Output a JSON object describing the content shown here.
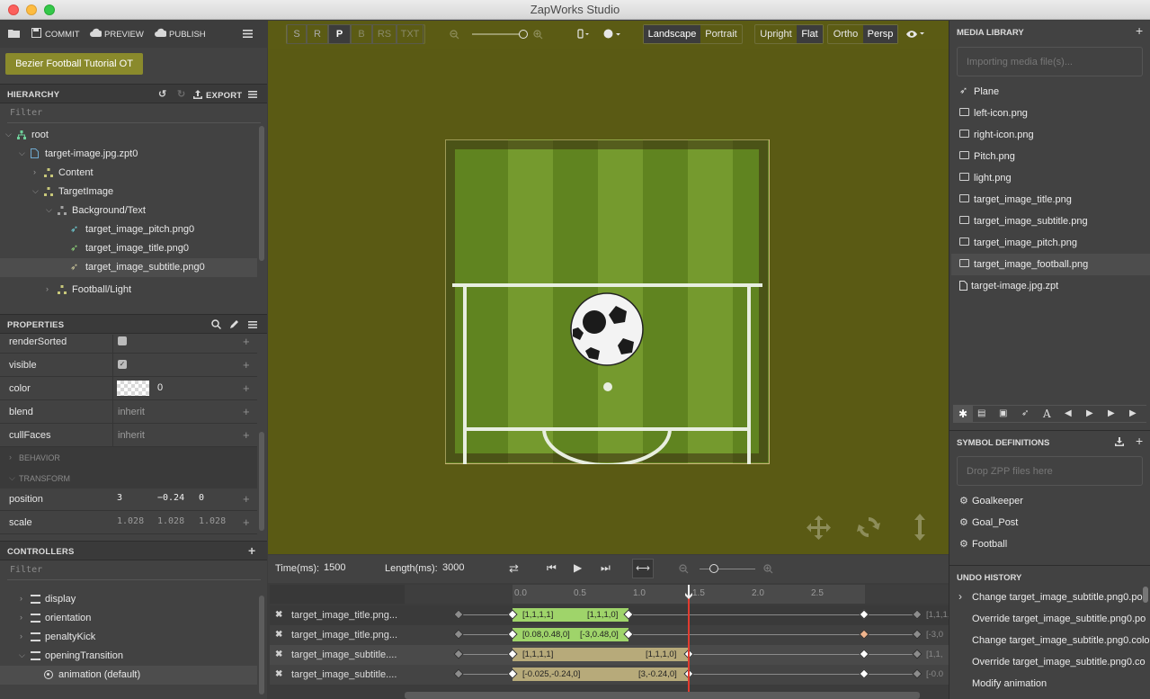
{
  "window": {
    "title": "ZapWorks Studio"
  },
  "colors": {
    "accent_gold": "#8a8a2c",
    "viewport_bg": "#5a5a14",
    "keyframe_green": "#9fd46a",
    "keyframe_tan": "#b7aa7a",
    "playhead": "#e23b2f",
    "diamond_orange": "#f0b48c"
  },
  "top_toolbar": {
    "commit": "COMMIT",
    "preview": "PREVIEW",
    "publish": "PUBLISH",
    "project_button": "Bezier Football Tutorial OT"
  },
  "hierarchy": {
    "title": "HIERARCHY",
    "export": "EXPORT",
    "filter": "Filter",
    "items": [
      {
        "label": "root"
      },
      {
        "label": "target-image.jpg.zpt0"
      },
      {
        "label": "Content"
      },
      {
        "label": "TargetImage"
      },
      {
        "label": "Background/Text"
      },
      {
        "label": "target_image_pitch.png0"
      },
      {
        "label": "target_image_title.png0"
      },
      {
        "label": "target_image_subtitle.png0"
      },
      {
        "label": "Football/Light"
      }
    ]
  },
  "properties": {
    "title": "PROPERTIES",
    "rows": [
      {
        "name": "renderSorted"
      },
      {
        "name": "visible"
      },
      {
        "name": "color",
        "value": "0"
      },
      {
        "name": "blend",
        "value": "inherit"
      },
      {
        "name": "cullFaces",
        "value": "inherit"
      }
    ],
    "behavior": "BEHAVIOR",
    "transform": "TRANSFORM",
    "position": {
      "name": "position",
      "x": "3",
      "y": "−0.24",
      "z": "0"
    },
    "scale": {
      "name": "scale",
      "x": "1.028",
      "y": "1.028",
      "z": "1.028"
    }
  },
  "controllers": {
    "title": "CONTROLLERS",
    "filter": "Filter",
    "items": [
      {
        "label": "display"
      },
      {
        "label": "orientation"
      },
      {
        "label": "penaltyKick"
      },
      {
        "label": "openingTransition"
      },
      {
        "label": "animation (default)"
      }
    ]
  },
  "viewport_toolbar": {
    "modes": [
      "S",
      "R",
      "P",
      "B",
      "RS",
      "TXT"
    ],
    "active_mode": "P",
    "orientation": [
      "Landscape",
      "Portrait"
    ],
    "view": [
      "Upright",
      "Flat"
    ],
    "projection": [
      "Ortho",
      "Persp"
    ]
  },
  "timeline": {
    "time_label": "Time(ms):",
    "time_value": "1500",
    "length_label": "Length(ms):",
    "length_value": "3000",
    "ruler": [
      "0.0",
      "0.5",
      "1.0",
      "1.5",
      "2.0",
      "2.5"
    ],
    "tracks": [
      {
        "name": "target_image_title.png...",
        "k1": "[1,1,1,1]",
        "k2": "[1,1,1,0]",
        "end": "[1,1,1,"
      },
      {
        "name": "target_image_title.png...",
        "k1": "[0.08,0.48,0]",
        "k2": "[-3,0.48,0]",
        "end": "[-3,0"
      },
      {
        "name": "target_image_subtitle....",
        "k1": "[1,1,1,1]",
        "k2": "[1,1,1,0]",
        "end": "[1,1,"
      },
      {
        "name": "target_image_subtitle....",
        "k1": "[-0.025,-0.24,0]",
        "k2": "[3,-0.24,0]",
        "end": "[-0.0"
      }
    ]
  },
  "media_library": {
    "title": "MEDIA LIBRARY",
    "drop_hint": "Importing media file(s)...",
    "items": [
      {
        "label": "Plane"
      },
      {
        "label": "left-icon.png"
      },
      {
        "label": "right-icon.png"
      },
      {
        "label": "Pitch.png"
      },
      {
        "label": "light.png"
      },
      {
        "label": "target_image_title.png"
      },
      {
        "label": "target_image_subtitle.png"
      },
      {
        "label": "target_image_pitch.png"
      },
      {
        "label": "target_image_football.png"
      },
      {
        "label": "target-image.jpg.zpt"
      }
    ]
  },
  "symbol_definitions": {
    "title": "SYMBOL DEFINITIONS",
    "drop_hint": "Drop ZPP files here",
    "items": [
      {
        "label": "Goalkeeper"
      },
      {
        "label": "Goal_Post"
      },
      {
        "label": "Football"
      }
    ]
  },
  "undo_history": {
    "title": "UNDO HISTORY",
    "items": [
      {
        "label": "Change target_image_subtitle.png0.pos"
      },
      {
        "label": "Override target_image_subtitle.png0.po"
      },
      {
        "label": "Change target_image_subtitle.png0.colo"
      },
      {
        "label": "Override target_image_subtitle.png0.co"
      },
      {
        "label": "Modify animation"
      }
    ]
  }
}
